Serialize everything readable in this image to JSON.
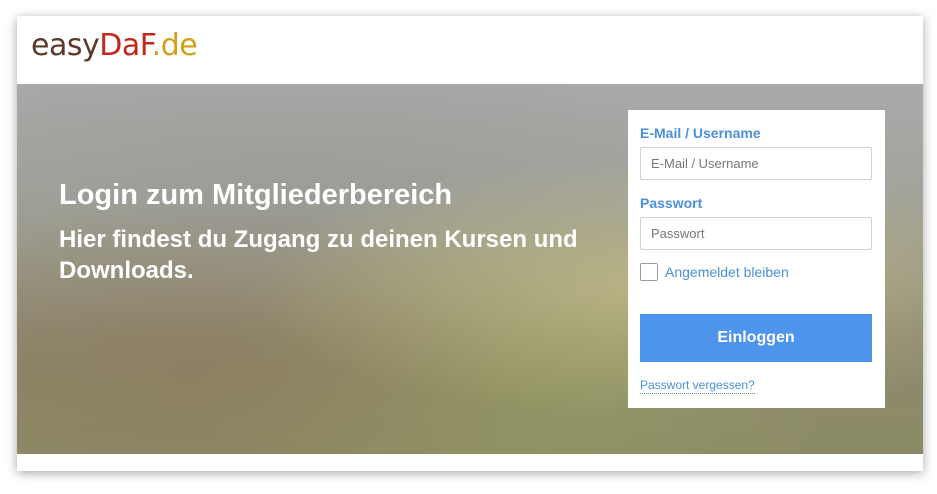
{
  "header": {
    "logo": {
      "part1": "easy",
      "part2": "DaF",
      "part3": ".de"
    }
  },
  "hero": {
    "title": "Login zum Mitgliederbereich",
    "subtitle": "Hier findest du Zugang zu deinen Kursen und Downloads."
  },
  "login": {
    "email_label": "E-Mail / Username",
    "email_placeholder": "E-Mail / Username",
    "email_value": "",
    "password_label": "Passwort",
    "password_placeholder": "Passwort",
    "password_value": "",
    "remember_label": "Angemeldet bleiben",
    "remember_checked": false,
    "submit_label": "Einloggen",
    "forgot_label": "Passwort vergessen?"
  },
  "colors": {
    "accent": "#4a8fe0",
    "button": "#4e94ec",
    "logo_dark": "#5a3a2a",
    "logo_red": "#c4281c",
    "logo_gold": "#d4a018"
  }
}
